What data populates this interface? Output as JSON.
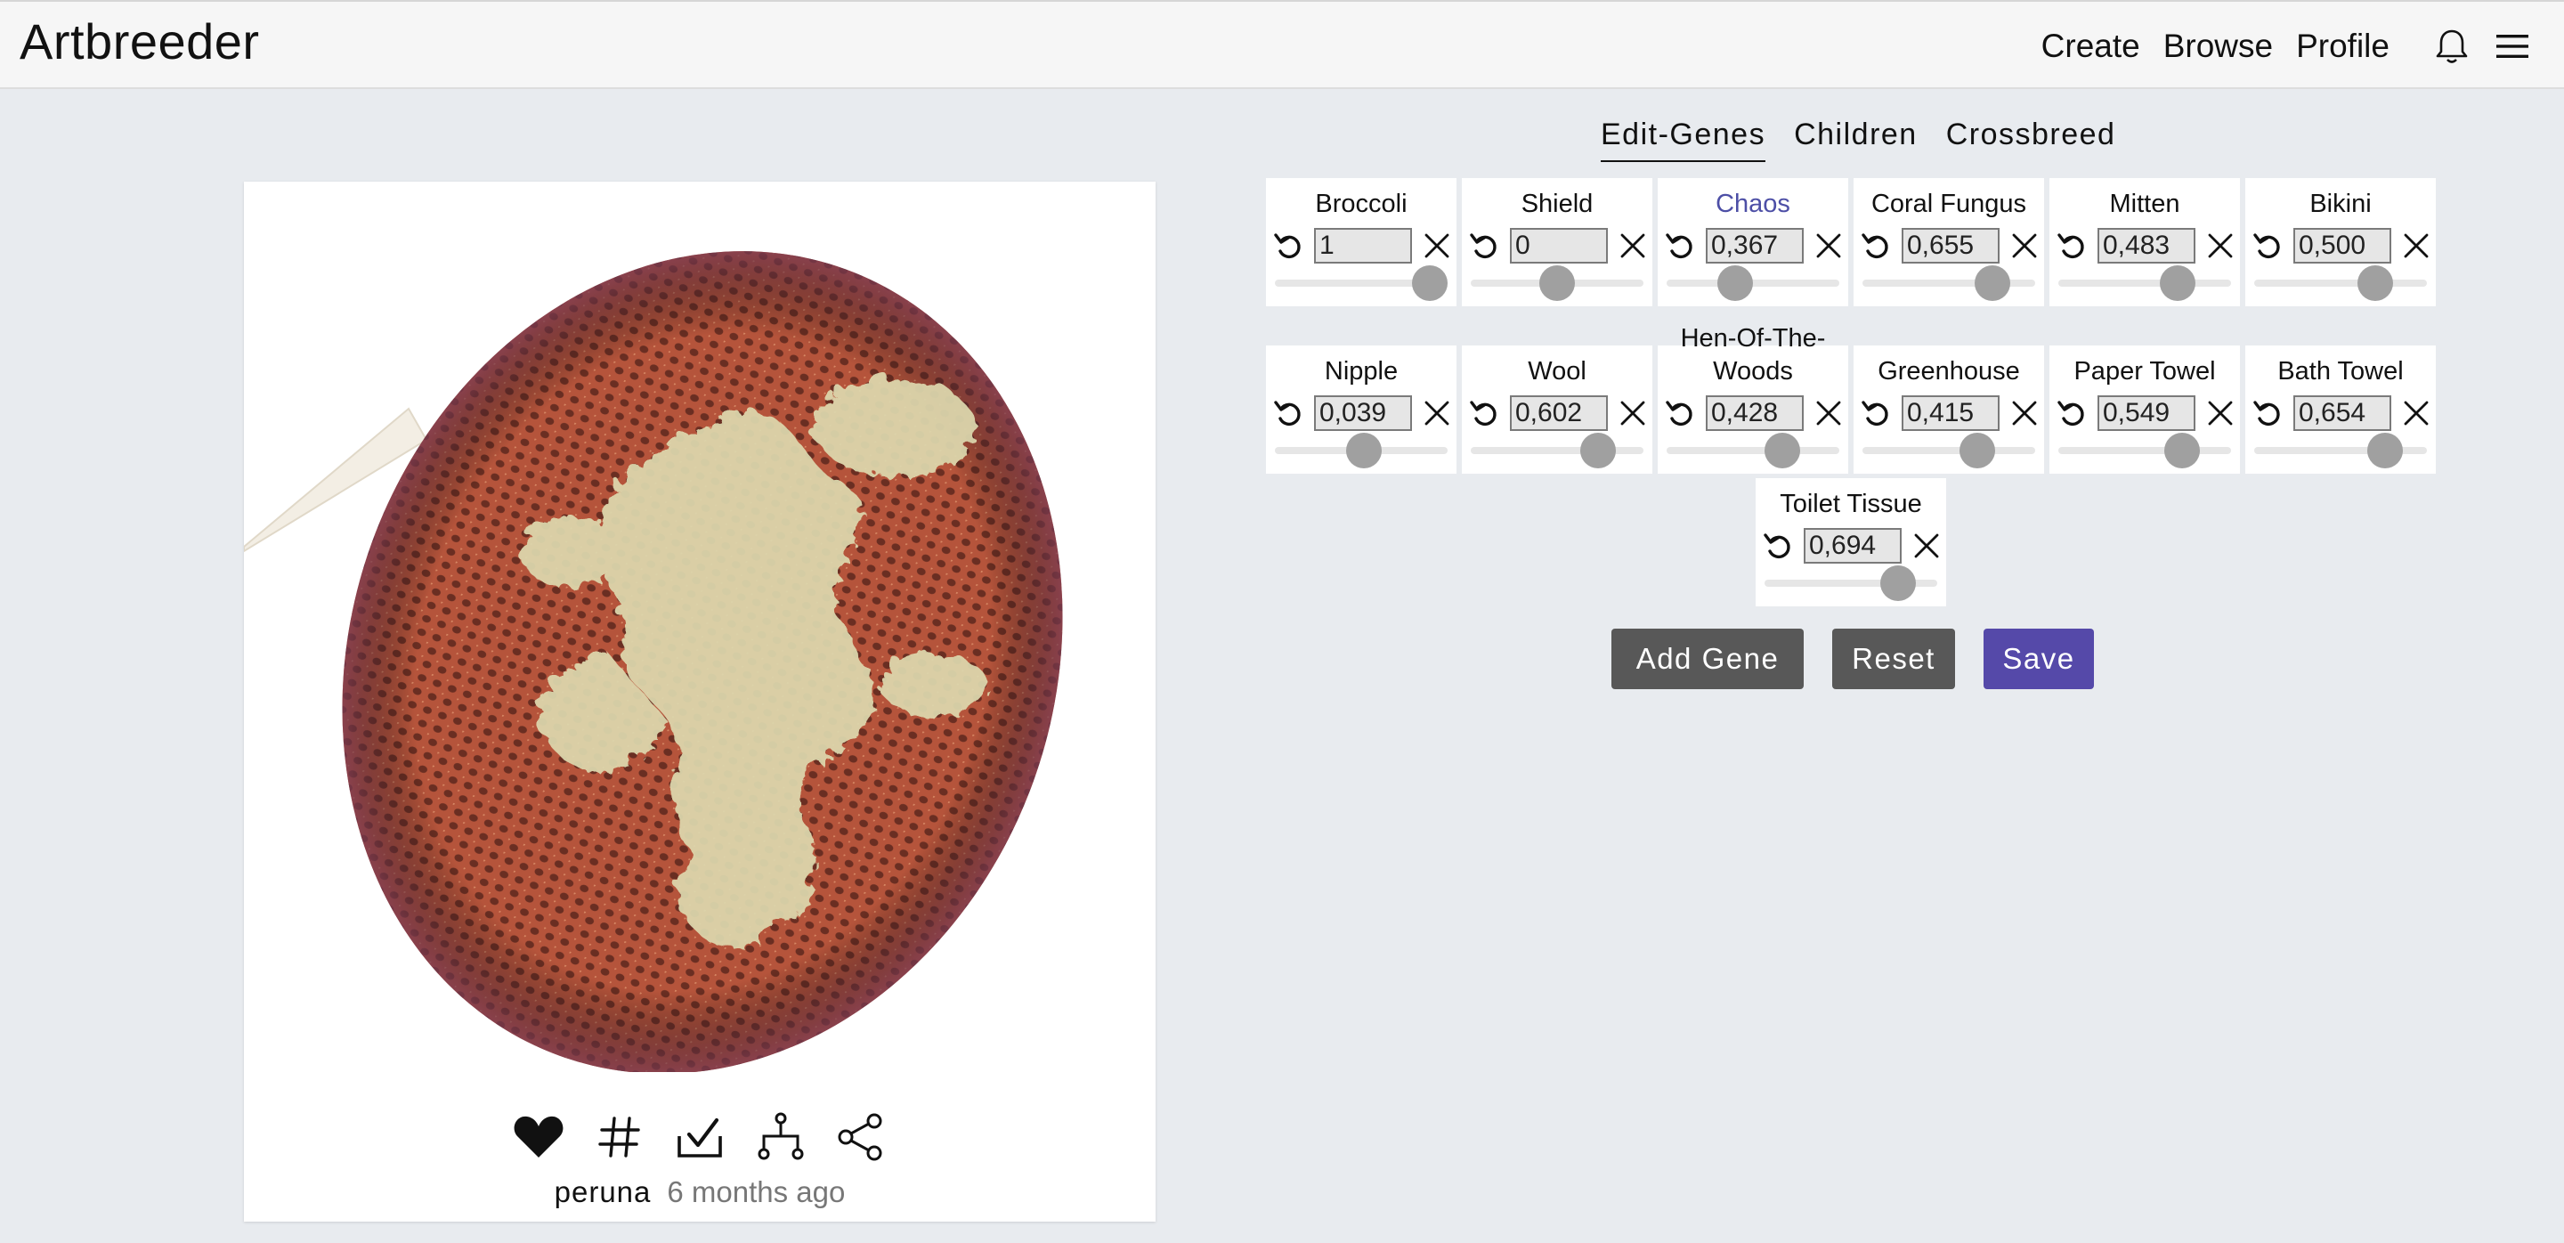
{
  "app": {
    "brand": "Artbreeder"
  },
  "nav": {
    "create": "Create",
    "browse": "Browse",
    "profile": "Profile"
  },
  "icons": {
    "notifications": "bell-icon",
    "menu": "hamburger-menu-icon",
    "like": "heart-icon",
    "tags": "hashtag-icon",
    "select": "checkbox-check-icon",
    "lineage": "family-tree-icon",
    "share": "share-icon",
    "gene_reset": "undo-icon",
    "gene_remove": "close-icon"
  },
  "tabs": [
    {
      "label": "Edit-Genes",
      "active": true
    },
    {
      "label": "Children",
      "active": false
    },
    {
      "label": "Crossbreed",
      "active": false
    }
  ],
  "genes": [
    {
      "name": "Broccoli",
      "value": "1",
      "level": 1.0
    },
    {
      "name": "Shield",
      "value": "0",
      "level": 0.5
    },
    {
      "name": "Chaos",
      "value": "0,367",
      "level": 0.367,
      "highlight": true
    },
    {
      "name": "Coral Fungus",
      "value": "0,655",
      "level": 0.82
    },
    {
      "name": "Mitten",
      "value": "0,483",
      "level": 0.742
    },
    {
      "name": "Bikini",
      "value": "0,500",
      "level": 0.75
    },
    {
      "name": "Nipple",
      "value": "0,039",
      "level": 0.52
    },
    {
      "name": "Wool",
      "value": "0,602",
      "level": 0.8
    },
    {
      "name": "Hen-Of-The-Woods",
      "value": "0,428",
      "level": 0.714
    },
    {
      "name": "Greenhouse",
      "value": "0,415",
      "level": 0.708
    },
    {
      "name": "Paper Towel",
      "value": "0,549",
      "level": 0.775
    },
    {
      "name": "Bath Towel",
      "value": "0,654",
      "level": 0.827
    },
    {
      "name": "Toilet Tissue",
      "value": "0,694",
      "level": 0.847
    }
  ],
  "buttons": {
    "add_gene": "Add Gene",
    "reset": "Reset",
    "save": "Save"
  },
  "post": {
    "author": "peruna",
    "time": "6 months ago"
  },
  "colors": {
    "accent": "#5549a9",
    "gene_highlight": "#4d4fa6",
    "button_dark": "#585858",
    "background": "#e8ebef"
  }
}
